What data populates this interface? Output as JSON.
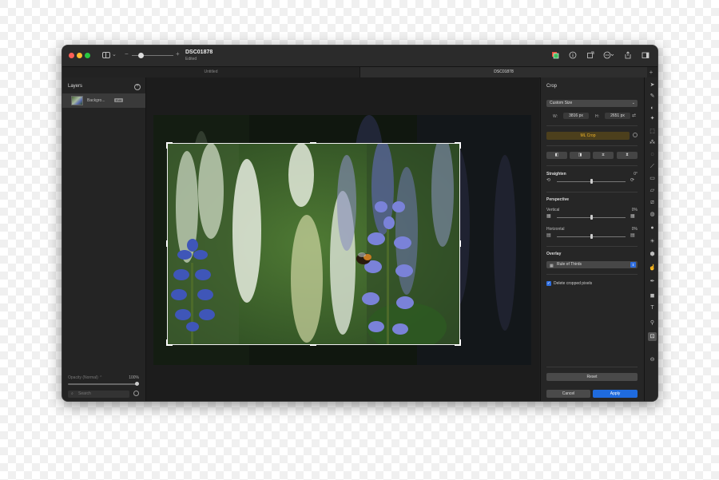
{
  "window": {
    "title": "DSC01878",
    "subtitle": "Edited",
    "zoom_minus": "−",
    "zoom_plus": "+"
  },
  "titlebar_icons": [
    "layers-stack-icon",
    "info-icon",
    "export-icon",
    "more-icon",
    "share-icon",
    "sidebar-right-icon"
  ],
  "tabs": [
    {
      "label": "Untitled",
      "active": false
    },
    {
      "label": "DSC01878",
      "active": true
    }
  ],
  "tab_add": "+",
  "layers": {
    "title": "Layers",
    "add": "+",
    "items": [
      {
        "name": "Backgro...",
        "badge": "Edit"
      }
    ],
    "opacity_label": "Opacity (Normal) ⌃",
    "opacity_value": "100%",
    "opacity_fraction": 1.0,
    "search_placeholder": "Search",
    "search_icon": "⌕"
  },
  "crop": {
    "title": "Crop",
    "size_preset": "Custom Size",
    "width_label": "W:",
    "width_value": "3816 px",
    "height_label": "H:",
    "height_value": "2651 px",
    "swap_icon": "⇄",
    "ml_crop_label": "ML Crop",
    "tool_buttons": [
      "◧",
      "◨",
      "⧖",
      "⧗"
    ],
    "straighten": {
      "label": "Straighten",
      "value": "0°",
      "fraction": 0.5
    },
    "perspective": {
      "label": "Perspective",
      "vertical": {
        "label": "Vertical",
        "value": "0%",
        "fraction": 0.5
      },
      "horizontal": {
        "label": "Horizontal",
        "value": "0%",
        "fraction": 0.5
      }
    },
    "overlay": {
      "label": "Overlay",
      "value": "Rule of Thirds",
      "grid_icon": "▦",
      "stepper": "⇕"
    },
    "delete_cropped": {
      "label": "Delete cropped pixels",
      "checked": true,
      "mark": "✓"
    },
    "reset_label": "Reset",
    "cancel_label": "Cancel",
    "apply_label": "Apply"
  },
  "toolbar": [
    {
      "name": "pointer-tool-icon",
      "glyph": "➤"
    },
    {
      "name": "paint-tool-icon",
      "glyph": "✎"
    },
    {
      "name": "color-adjust-tool-icon",
      "glyph": "◐"
    },
    {
      "name": "magic-tool-icon",
      "glyph": "✦"
    },
    {
      "name": "selection-tool-icon",
      "glyph": "⬚"
    },
    {
      "name": "magic-wand-tool-icon",
      "glyph": "⁂"
    },
    {
      "name": "quick-select-tool-icon",
      "glyph": "◌"
    },
    {
      "name": "brush-tool-icon",
      "glyph": "⟋"
    },
    {
      "name": "bucket-tool-icon",
      "glyph": "▭"
    },
    {
      "name": "eraser-tool-icon",
      "glyph": "▱"
    },
    {
      "name": "bandage-tool-icon",
      "glyph": "⧄"
    },
    {
      "name": "clone-tool-icon",
      "glyph": "◍"
    },
    {
      "name": "blur-tool-icon",
      "glyph": "●"
    },
    {
      "name": "lighten-tool-icon",
      "glyph": "☀"
    },
    {
      "name": "sponge-tool-icon",
      "glyph": "⬢"
    },
    {
      "name": "smudge-tool-icon",
      "glyph": "☝"
    },
    {
      "name": "pen-tool-icon",
      "glyph": "✒"
    },
    {
      "name": "shape-tool-icon",
      "glyph": "◼"
    },
    {
      "name": "text-tool-icon",
      "glyph": "T"
    },
    {
      "name": "zoom-tool-icon",
      "glyph": "⚲"
    },
    {
      "name": "crop-tool-icon",
      "glyph": "⊡",
      "active": true
    },
    {
      "name": "more-tools-icon",
      "glyph": "⊖"
    }
  ],
  "colors": {
    "accent": "#1f6bde",
    "ml_crop": "#f0b429",
    "window_bg": "#1f1f1f"
  }
}
